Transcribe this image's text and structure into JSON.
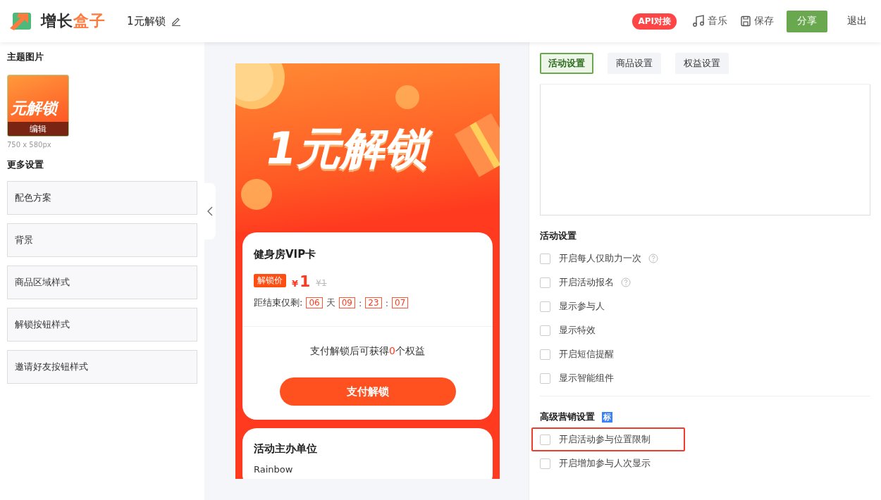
{
  "header": {
    "brand": [
      "增长",
      "盒子"
    ],
    "doc_title": "1元解锁",
    "api_badge": "API对接",
    "music": "音乐",
    "save": "保存",
    "share": "分享",
    "exit": "退出"
  },
  "left": {
    "theme_title": "主题图片",
    "thumb_text": "元解锁",
    "thumb_edit": "编辑",
    "thumb_size": "750 x 580px",
    "more_title": "更多设置",
    "items": [
      {
        "label": "配色方案"
      },
      {
        "label": "背景"
      },
      {
        "label": "商品区域样式"
      },
      {
        "label": "解锁按钮样式"
      },
      {
        "label": "邀请好友按钮样式"
      }
    ]
  },
  "preview": {
    "banner_text": "1元解锁",
    "product": "健身房VIP卡",
    "price_tag": "解锁价",
    "currency": "¥",
    "price": "1",
    "old_price": "¥1",
    "countdown_label": "距结束仅剩:",
    "countdown": [
      {
        "value": "06",
        "sep": "天"
      },
      {
        "value": "09",
        "sep": ":"
      },
      {
        "value": "23",
        "sep": ":"
      },
      {
        "value": "07"
      }
    ],
    "benefit_text": [
      "支付解锁后可获得",
      "0",
      "个权益"
    ],
    "pay_button": "支付解锁",
    "organizer_title": "活动主办单位",
    "organizer": "Rainbow"
  },
  "right": {
    "tabs": [
      {
        "label": "活动设置",
        "selected": true
      },
      {
        "label": "商品设置",
        "selected": false
      },
      {
        "label": "权益设置",
        "selected": false
      }
    ],
    "sections": [
      {
        "title": "活动设置",
        "options": [
          {
            "label": "开启每人仅助力一次",
            "checked": false,
            "help": true,
            "highlighted": false
          },
          {
            "label": "开启活动报名",
            "checked": false,
            "help": true,
            "highlighted": false
          },
          {
            "label": "显示参与人",
            "checked": false,
            "help": false,
            "highlighted": false
          },
          {
            "label": "显示特效",
            "checked": false,
            "help": false,
            "highlighted": false
          },
          {
            "label": "开启短信提醒",
            "checked": false,
            "help": false,
            "highlighted": false
          },
          {
            "label": "显示智能组件",
            "checked": false,
            "help": false,
            "highlighted": false
          }
        ]
      },
      {
        "title": "高级营销设置",
        "badge": "标",
        "options": [
          {
            "label": "开启活动参与位置限制",
            "checked": false,
            "help": false,
            "highlighted": true
          },
          {
            "label": "开启增加参与人次显示",
            "checked": false,
            "help": false,
            "highlighted": false
          }
        ]
      }
    ]
  }
}
